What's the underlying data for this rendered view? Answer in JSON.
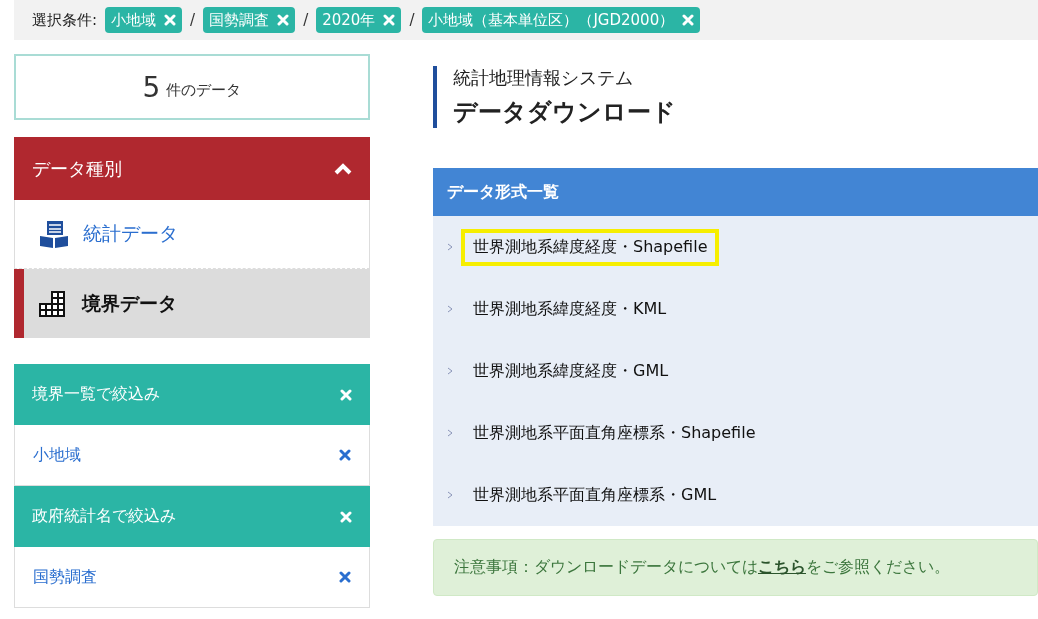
{
  "conditions": {
    "label": "選択条件:",
    "separator": "/",
    "chips": [
      "小地域",
      "国勢調査",
      "2020年",
      "小地域（基本単位区）（JGD2000）"
    ]
  },
  "count": {
    "number": "5",
    "unit": "件のデータ"
  },
  "data_type": {
    "title": "データ種別",
    "expanded": true,
    "items": [
      {
        "label": "統計データ",
        "kind": "table",
        "selected": false
      },
      {
        "label": "境界データ",
        "kind": "grid",
        "selected": true
      }
    ]
  },
  "filters": [
    {
      "title": "境界一覧で絞込み",
      "value": "小地域"
    },
    {
      "title": "政府統計名で絞込み",
      "value": "国勢調査"
    }
  ],
  "heading": {
    "subtitle": "統計地理情報システム",
    "title": "データダウンロード"
  },
  "formats": {
    "title": "データ形式一覧",
    "items": [
      {
        "label": "世界測地系緯度経度・Shapefile",
        "highlighted": true
      },
      {
        "label": "世界測地系緯度経度・KML",
        "highlighted": false
      },
      {
        "label": "世界測地系緯度経度・GML",
        "highlighted": false
      },
      {
        "label": "世界測地系平面直角座標系・Shapefile",
        "highlighted": false
      },
      {
        "label": "世界測地系平面直角座標系・GML",
        "highlighted": false
      }
    ]
  },
  "notice": {
    "before": "注意事項：ダウンロードデータについては",
    "link": "こちら",
    "after": "をご参照ください。"
  }
}
